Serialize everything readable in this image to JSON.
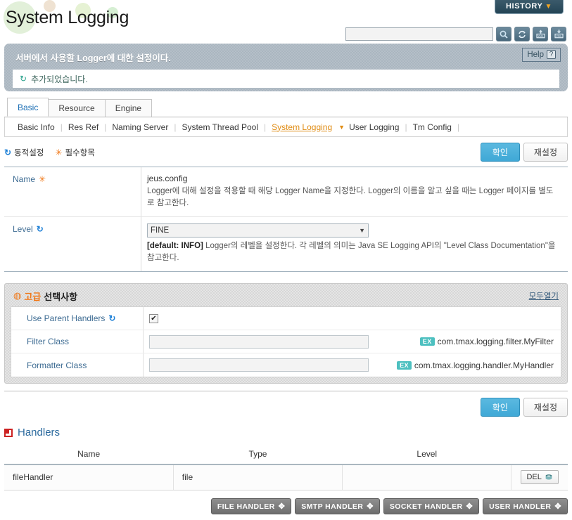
{
  "header": {
    "page_title": "System Logging",
    "history_button": "HISTORY",
    "history_caret": "▼",
    "search_placeholder": "",
    "search_value": "",
    "icons": {
      "search": "search-icon",
      "refresh": "refresh-icon",
      "xml_export": "xml-export-icon",
      "xml_import": "xml-import-icon"
    }
  },
  "description_panel": {
    "title": "서버에서 사용할 Logger에 대한 설정이다.",
    "help_label": "Help",
    "help_mark": "?",
    "notice_icon": "↻",
    "notice_text": "추가되었습니다."
  },
  "tabs": [
    {
      "label": "Basic",
      "active": true
    },
    {
      "label": "Resource",
      "active": false
    },
    {
      "label": "Engine",
      "active": false
    }
  ],
  "subnav": [
    {
      "label": "Basic Info",
      "active": false
    },
    {
      "label": "Res Ref",
      "active": false
    },
    {
      "label": "Naming Server",
      "active": false
    },
    {
      "label": "System Thread Pool",
      "active": false
    },
    {
      "label": "System Logging",
      "active": true
    },
    {
      "label": "User Logging",
      "active": false
    },
    {
      "label": "Tm Config",
      "active": false
    }
  ],
  "legend": {
    "dynamic_icon": "↻",
    "dynamic_label": "동적설정",
    "required_icon": "✳",
    "required_label": "필수항목"
  },
  "buttons": {
    "confirm": "확인",
    "reset": "재설정"
  },
  "basic_form": [
    {
      "label": "Name",
      "badge": "required",
      "value": "jeus.config",
      "help": "Logger에 대해 설정을 적용할 때 해당 Logger Name을 지정한다. Logger의 이름을 알고 싶을 때는 Logger 페이지를 별도로 참고한다."
    },
    {
      "label": "Level",
      "badge": "dynamic",
      "select_value": "FINE",
      "help_default": "[default: INFO]",
      "help": "Logger의 레벨을 설정한다. 각 레벨의 의미는 Java SE Logging API의 \"Level Class Documentation\"을 참고한다."
    }
  ],
  "advanced": {
    "bulb_icon": "💡",
    "title_highlight": "고급",
    "title_rest": "선택사항",
    "expand_all": "모두열기",
    "rows": [
      {
        "label": "Use Parent Handlers",
        "badge": "dynamic",
        "control": "checkbox",
        "checked": true,
        "check_mark": "✔"
      },
      {
        "label": "Filter Class",
        "badge": "none",
        "control": "text",
        "value": "",
        "ex_badge": "EX",
        "ex_text": "com.tmax.logging.filter.MyFilter"
      },
      {
        "label": "Formatter Class",
        "badge": "none",
        "control": "text",
        "value": "",
        "ex_badge": "EX",
        "ex_text": "com.tmax.logging.handler.MyHandler"
      }
    ]
  },
  "handlers": {
    "section_title": "Handlers",
    "columns": [
      "Name",
      "Type",
      "Level"
    ],
    "rows": [
      {
        "name": "fileHandler",
        "type": "file",
        "level": "",
        "delete_label": "DEL"
      }
    ],
    "add_buttons": [
      {
        "label": "FILE HANDLER"
      },
      {
        "label": "SMTP HANDLER"
      },
      {
        "label": "SOCKET HANDLER"
      },
      {
        "label": "USER HANDLER"
      }
    ]
  }
}
